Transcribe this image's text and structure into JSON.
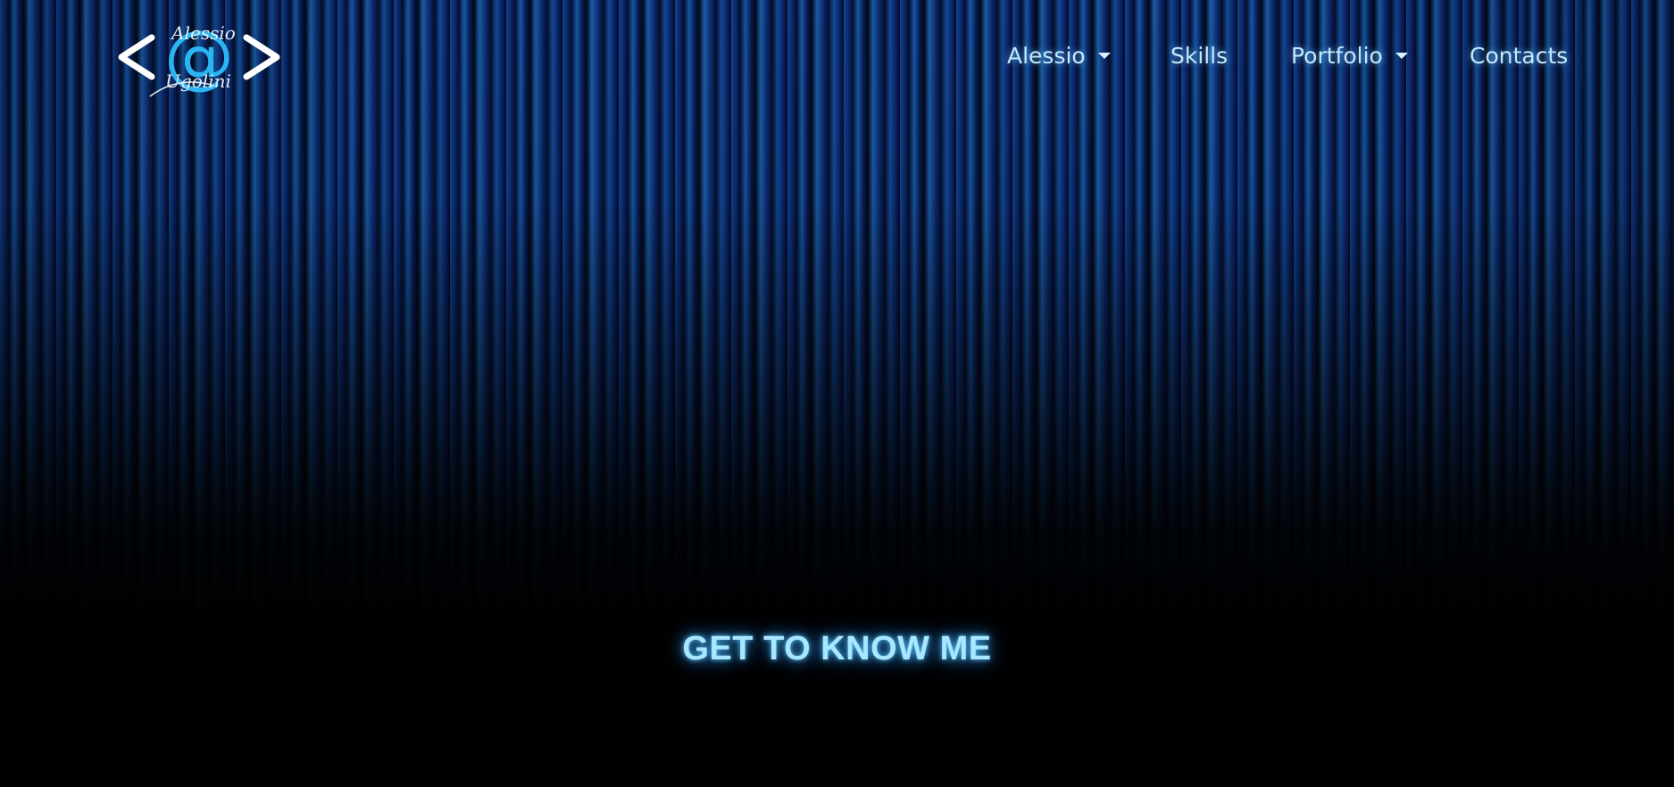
{
  "logo": {
    "left_bracket": "<",
    "right_bracket": ">",
    "at_symbol": "@",
    "top_word": "Alessio",
    "bottom_word": "Ugolini",
    "accent_color": "#2bb5f0"
  },
  "nav": {
    "items": [
      {
        "label": "Alessio",
        "has_dropdown": true
      },
      {
        "label": "Skills",
        "has_dropdown": false
      },
      {
        "label": "Portfolio",
        "has_dropdown": true
      },
      {
        "label": "Contacts",
        "has_dropdown": false
      }
    ]
  },
  "hero": {
    "cta_label": "GET TO KNOW ME"
  },
  "colors": {
    "nav_text": "#bfe9ff",
    "cta_glow": "#5ac8ff",
    "background": "#000000"
  }
}
